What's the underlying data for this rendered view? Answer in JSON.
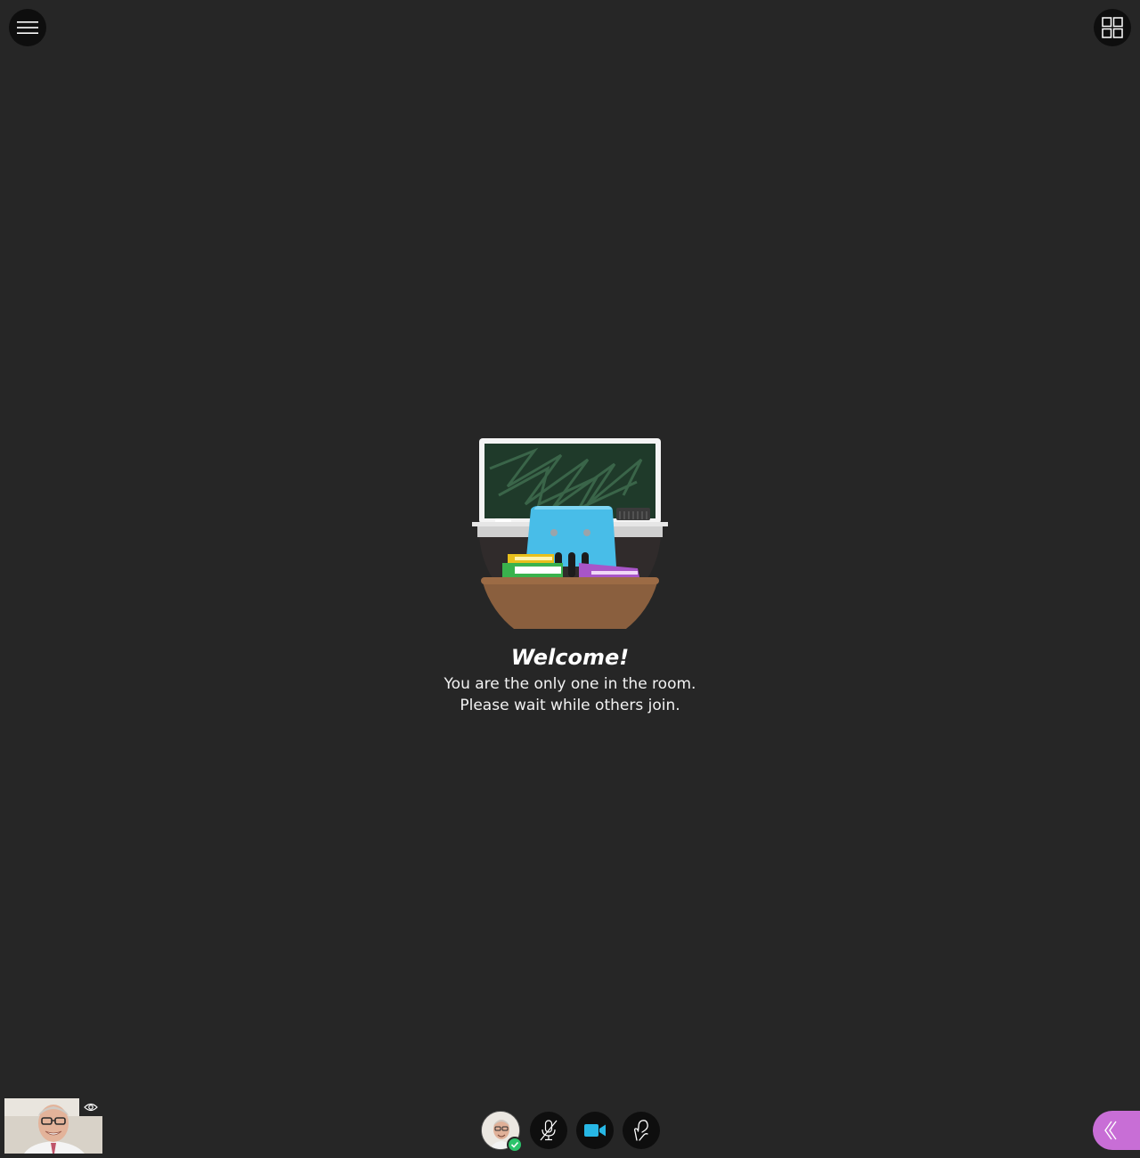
{
  "topbar": {
    "menu_icon": "hamburger-menu-icon",
    "layout_icon": "grid-layout-icon"
  },
  "welcome": {
    "title": "Welcome!",
    "line1": "You are the only one in the room.",
    "line2": "Please wait while others join."
  },
  "self_view": {
    "visibility_icon": "eye-icon"
  },
  "controls": {
    "avatar_status_icon": "check-icon",
    "microphone_icon": "microphone-muted-icon",
    "camera_icon": "video-camera-icon",
    "hand_icon": "raise-hand-icon"
  },
  "colors": {
    "background": "#262626",
    "button_bg": "#0e0e0e",
    "camera_active": "#27b7e5",
    "status_green": "#2cc36b",
    "panel_toggle": "#c86ed6"
  },
  "panel": {
    "toggle_icon": "chevron-double-left-icon"
  }
}
